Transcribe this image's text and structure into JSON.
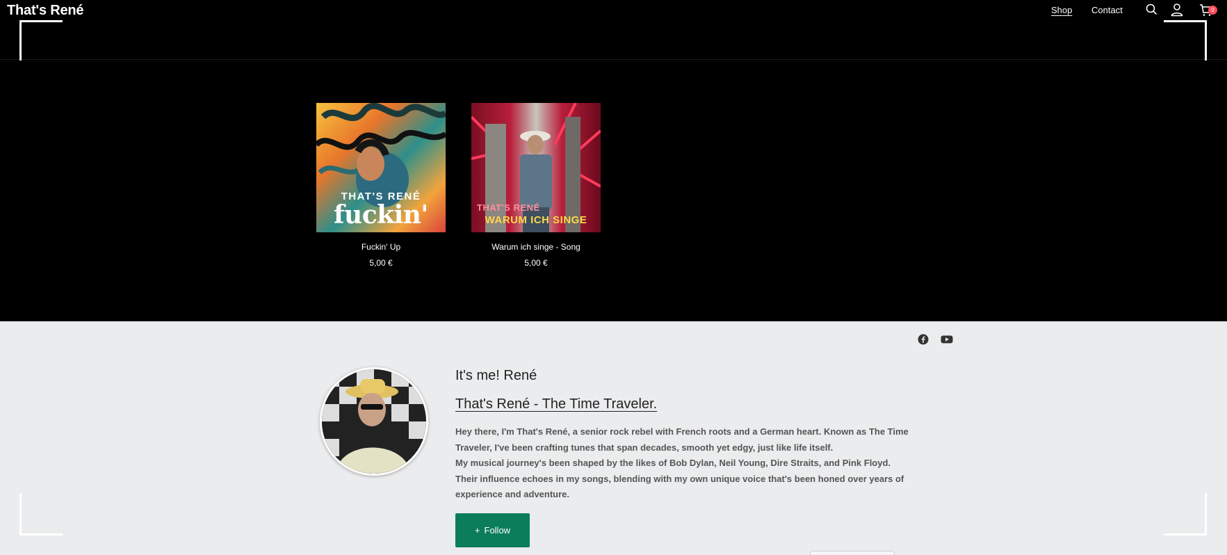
{
  "header": {
    "brand": "That's René",
    "nav": [
      {
        "label": "Shop"
      },
      {
        "label": "Contact"
      }
    ],
    "cart_count": "0"
  },
  "products": [
    {
      "name": "Fuckin' Up",
      "price": "5,00 €",
      "art_caption_top": "THAT'S RENÉ",
      "art_caption_bottom": "fuckin' up"
    },
    {
      "name": "Warum ich singe - Song",
      "price": "5,00 €",
      "art_caption_top": "THAT'S RENÉ",
      "art_caption_bottom": "WARUM ICH SINGE"
    }
  ],
  "profile": {
    "heading": "It's me! René",
    "subtitle": "That's René - The Time Traveler.",
    "bio_1": "Hey there, I'm That's René, a senior rock rebel with French roots and a German heart. Known as The Time Traveler, I've been crafting tunes that span decades, smooth yet edgy, just like life itself.",
    "bio_2": "My musical journey's been shaped by the likes of Bob Dylan, Neil Young, Dire Straits, and Pink Floyd. Their influence echoes in my songs, blending with my own unique voice that's been honed over years of experience and adventure.",
    "follow_label": "Follow"
  },
  "icons": {
    "search": "search-icon",
    "account": "user-icon",
    "cart": "cart-icon",
    "facebook": "facebook-icon",
    "youtube": "youtube-icon"
  },
  "colors": {
    "header_bg": "#000000",
    "page_bg": "#ebeced",
    "follow_button": "#0b7d5b",
    "cart_badge": "#ff4d5a"
  }
}
